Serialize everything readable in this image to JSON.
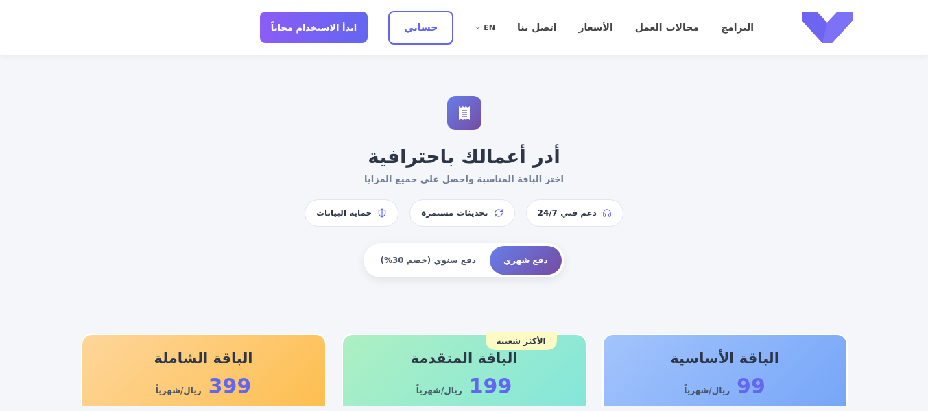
{
  "header": {
    "nav": [
      {
        "label": "البرامج"
      },
      {
        "label": "مجالات العمل"
      },
      {
        "label": "الأسعار"
      },
      {
        "label": "اتصل بنا"
      }
    ],
    "language": "EN",
    "account_button": "حسابي",
    "cta_button": "ابدأ الاستخدام مجاناً"
  },
  "hero": {
    "title": "أدر أعمالك باحترافية",
    "subtitle": "اختر الباقة المناسبة واحصل على جميع المزايا",
    "features": [
      {
        "label": "دعم فني 24/7",
        "kind": "support"
      },
      {
        "label": "تحديثات مستمرة",
        "kind": "updates"
      },
      {
        "label": "حماية البيانات",
        "kind": "security"
      }
    ],
    "billing": [
      {
        "label": "دفع شهري",
        "selected": true
      },
      {
        "label": "دفع سنوي (خصم 30%)",
        "selected": false
      }
    ]
  },
  "plans": [
    {
      "name": "الباقة الأساسية",
      "price": "99",
      "unit": "ريال/شهرياً",
      "kind": "blue"
    },
    {
      "name": "الباقة المتقدمة",
      "price": "199",
      "unit": "ريال/شهرياً",
      "kind": "green",
      "badge": "الأكثر شعبية"
    },
    {
      "name": "الباقة الشاملة",
      "price": "399",
      "unit": "ريال/شهرياً",
      "kind": "orange"
    }
  ]
}
